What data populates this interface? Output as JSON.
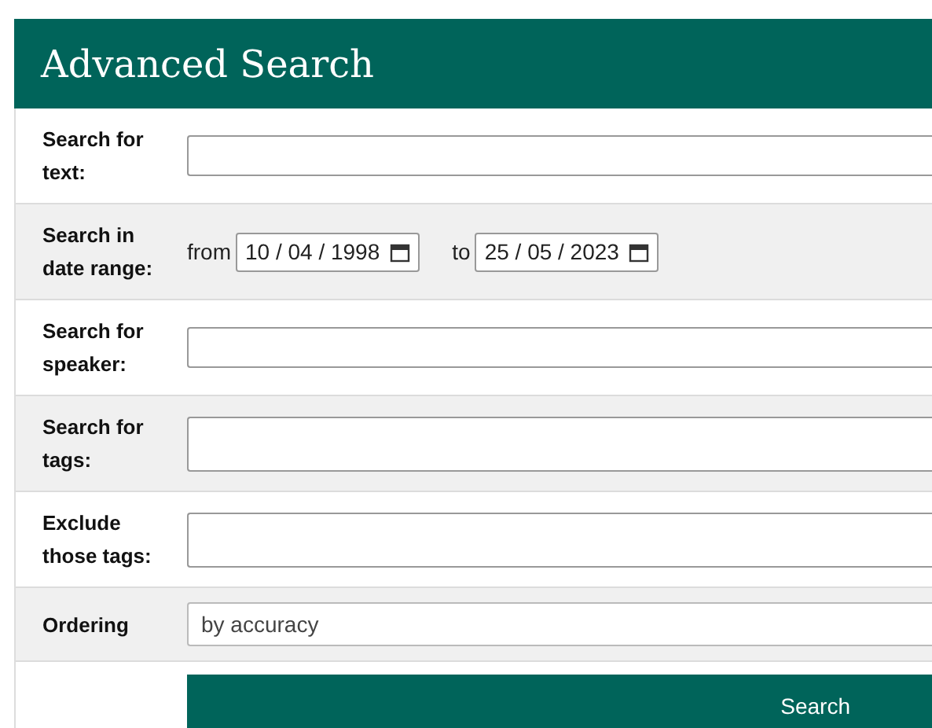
{
  "title": "Advanced Search",
  "rows": [
    {
      "kind": "text",
      "label": "Search for text:"
    },
    {
      "kind": "date_range",
      "label": "Search in date range:",
      "from_label": "from",
      "from_value": "10 / 04 / 1998",
      "to_label": "to",
      "to_value": "25 / 05 / 2023"
    },
    {
      "kind": "text",
      "label": "Search for speaker:"
    },
    {
      "kind": "textarea",
      "label": "Search for tags:"
    },
    {
      "kind": "textarea",
      "label": "Exclude those tags:"
    },
    {
      "kind": "select",
      "label": "Ordering",
      "value": "by accuracy"
    }
  ],
  "submit": "Search"
}
